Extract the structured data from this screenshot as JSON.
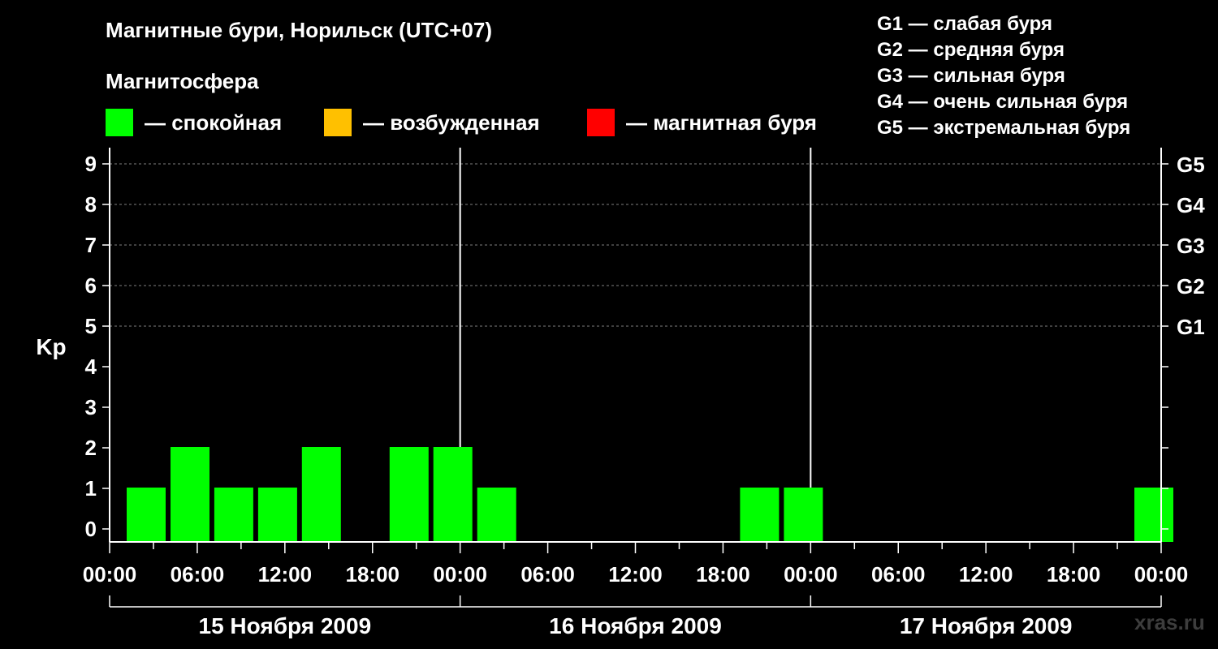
{
  "header": {
    "title": "Магнитные бури, Норильск (UTC+07)",
    "subtitle": "Магнитосфера"
  },
  "legend": [
    {
      "label": "— спокойная",
      "color": "#00ff00"
    },
    {
      "label": "— возбужденная",
      "color": "#ffc000"
    },
    {
      "label": "— магнитная буря",
      "color": "#ff0000"
    }
  ],
  "storm_scale": [
    "G1 — слабая буря",
    "G2 — средняя буря",
    "G3 — сильная буря",
    "G4 — очень сильная буря",
    "G5 — экстремальная буря"
  ],
  "watermark": "xras.ru",
  "chart_data": {
    "type": "bar",
    "ylabel": "Kp",
    "ylim": [
      0,
      9
    ],
    "y_ticks": [
      "0",
      "1",
      "2",
      "3",
      "4",
      "5",
      "6",
      "7",
      "8",
      "9"
    ],
    "right_ticks": [
      {
        "y": 5,
        "label": "G1"
      },
      {
        "y": 6,
        "label": "G2"
      },
      {
        "y": 7,
        "label": "G3"
      },
      {
        "y": 8,
        "label": "G4"
      },
      {
        "y": 9,
        "label": "G5"
      }
    ],
    "x_tick_labels": [
      "00:00",
      "06:00",
      "12:00",
      "18:00",
      "00:00",
      "06:00",
      "12:00",
      "18:00",
      "00:00",
      "06:00",
      "12:00",
      "18:00",
      "00:00"
    ],
    "days": [
      "15 Ноября 2009",
      "16 Ноября 2009",
      "17 Ноября 2009"
    ],
    "interval_hours": 3,
    "bar_color": "#00ff00",
    "grid": true,
    "bars": [
      {
        "start": "15 Ноября 2009 00:00",
        "kp": 1
      },
      {
        "start": "15 Ноября 2009 03:00",
        "kp": 2
      },
      {
        "start": "15 Ноября 2009 06:00",
        "kp": 1
      },
      {
        "start": "15 Ноября 2009 09:00",
        "kp": 1
      },
      {
        "start": "15 Ноября 2009 12:00",
        "kp": 2
      },
      {
        "start": "15 Ноября 2009 15:00",
        "kp": 0
      },
      {
        "start": "15 Ноября 2009 18:00",
        "kp": 2
      },
      {
        "start": "15 Ноября 2009 21:00",
        "kp": 2
      },
      {
        "start": "16 Ноября 2009 00:00",
        "kp": 1
      },
      {
        "start": "16 Ноября 2009 03:00",
        "kp": 0
      },
      {
        "start": "16 Ноября 2009 06:00",
        "kp": 0
      },
      {
        "start": "16 Ноября 2009 09:00",
        "kp": 0
      },
      {
        "start": "16 Ноября 2009 12:00",
        "kp": 0
      },
      {
        "start": "16 Ноября 2009 15:00",
        "kp": 0
      },
      {
        "start": "16 Ноября 2009 18:00",
        "kp": 1
      },
      {
        "start": "16 Ноября 2009 21:00",
        "kp": 1
      },
      {
        "start": "17 Ноября 2009 00:00",
        "kp": 0
      },
      {
        "start": "17 Ноября 2009 03:00",
        "kp": 0
      },
      {
        "start": "17 Ноября 2009 06:00",
        "kp": 0
      },
      {
        "start": "17 Ноября 2009 09:00",
        "kp": 0
      },
      {
        "start": "17 Ноября 2009 12:00",
        "kp": 0
      },
      {
        "start": "17 Ноября 2009 15:00",
        "kp": 0
      },
      {
        "start": "17 Ноября 2009 18:00",
        "kp": 0
      },
      {
        "start": "17 Ноября 2009 21:00",
        "kp": 1
      }
    ]
  }
}
